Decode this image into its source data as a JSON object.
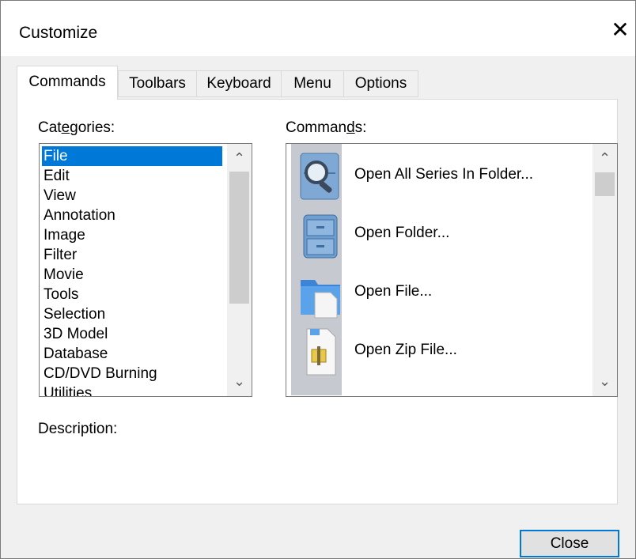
{
  "window": {
    "title": "Customize",
    "close_glyph": "✕"
  },
  "tabs": [
    {
      "label": "Commands",
      "active": true
    },
    {
      "label": "Toolbars",
      "active": false
    },
    {
      "label": "Keyboard",
      "active": false
    },
    {
      "label": "Menu",
      "active": false
    },
    {
      "label": "Options",
      "active": false
    }
  ],
  "categories": {
    "label_pre": "Cat",
    "label_ul": "e",
    "label_post": "gories:",
    "selected": "File",
    "items": [
      "File",
      "Edit",
      "View",
      "Annotation",
      "Image",
      "Filter",
      "Movie",
      "Tools",
      "Selection",
      "3D Model",
      "Database",
      "CD/DVD Burning",
      "Utilities"
    ]
  },
  "commands": {
    "label_pre": "Comman",
    "label_ul": "d",
    "label_post": "s:",
    "items": [
      {
        "label": "Open All Series In Folder...",
        "icon": "folder-search-icon"
      },
      {
        "label": "Open Folder...",
        "icon": "folder-cabinet-icon"
      },
      {
        "label": "Open File...",
        "icon": "open-file-icon"
      },
      {
        "label": "Open Zip File...",
        "icon": "zip-file-icon"
      }
    ]
  },
  "description": {
    "label": "Description:"
  },
  "buttons": {
    "close": "Close"
  },
  "scroll_glyphs": {
    "up": "⌃",
    "down": "⌄"
  },
  "colors": {
    "selection": "#0078d7",
    "focus_border": "#0078d7"
  }
}
